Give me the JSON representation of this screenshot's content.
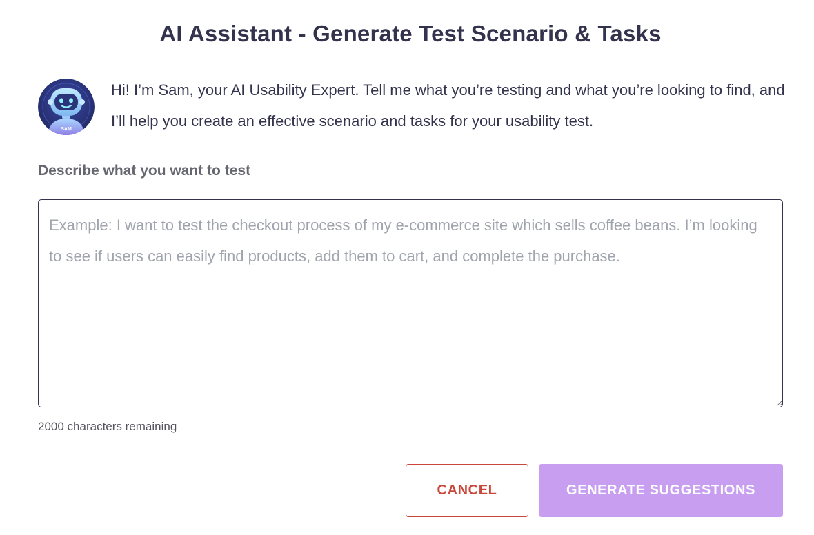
{
  "dialog": {
    "title": "AI Assistant - Generate Test Scenario & Tasks",
    "intro": "Hi! I’m Sam, your AI Usability Expert. Tell me what you’re testing and what you’re looking to find, and I’ll help you create an effective scenario and tasks for your usability test.",
    "avatar_badge": "SAM",
    "avatar_icon": "robot-avatar-icon"
  },
  "form": {
    "label": "Describe what you want to test",
    "value": "",
    "placeholder": "Example: I want to test the checkout process of my e-commerce site which sells coffee beans. I’m looking to see if users can easily find products, add them to cart, and complete the purchase.",
    "counter": "2000 characters remaining"
  },
  "actions": {
    "cancel_label": "CANCEL",
    "generate_label": "GENERATE SUGGESTIONS"
  },
  "colors": {
    "text": "#33334d",
    "cancel": "#c8473b",
    "generate_bg": "#c79ef0"
  }
}
